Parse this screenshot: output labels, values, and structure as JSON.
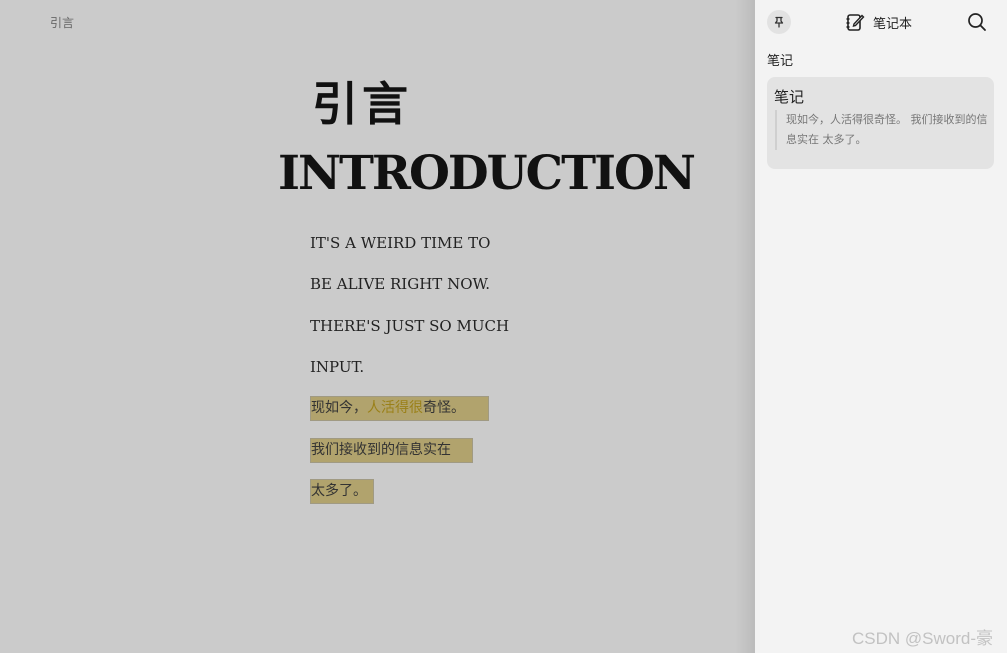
{
  "reader": {
    "header": "引言",
    "title_zh": "引言",
    "title_en": "INTRODUCTION",
    "lines": [
      "IT'S A WEIRD TIME TO",
      "BE ALIVE RIGHT NOW.",
      "THERE'S JUST SO MUCH",
      "INPUT."
    ],
    "highlight": {
      "line1_a": "现如今，",
      "line1_b": "人活得很",
      "line1_c": "奇怪。",
      "line2": "我们接收到的信息实在",
      "line3": "太多了。",
      "color": "#b1a36d"
    }
  },
  "panel": {
    "pin_icon": "pin-icon",
    "notebook_icon": "notebook-icon",
    "notebook_label": "笔记本",
    "search_icon": "search-icon",
    "section_label": "笔记",
    "note": {
      "title": "笔记",
      "quote": "现如今，人活得很奇怪。 我们接收到的信息实在 太多了。"
    }
  },
  "watermark": "CSDN @Sword-豪"
}
